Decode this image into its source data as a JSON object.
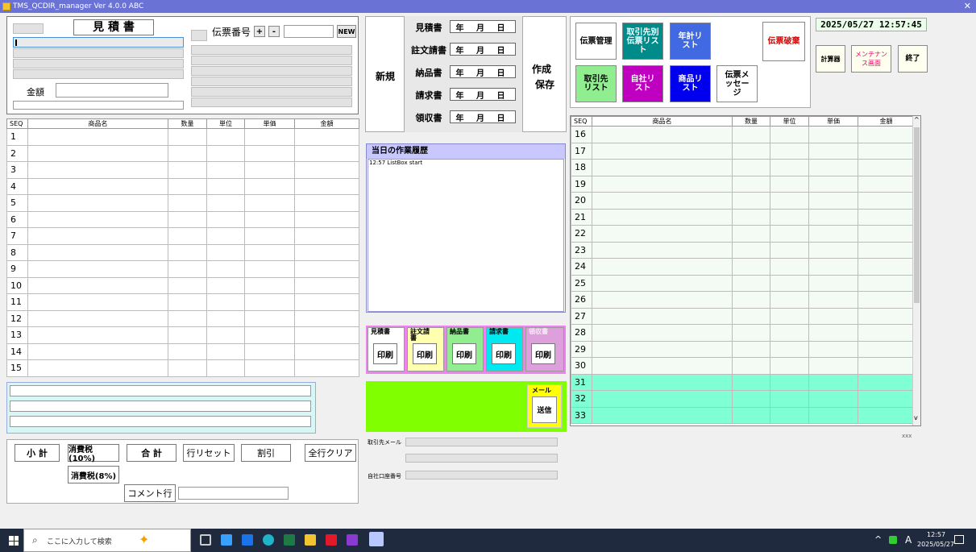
{
  "app": {
    "title": "TMS_QCDIR_manager Ver 4.0.0   ABC"
  },
  "form": {
    "doc_title": "見 積 書",
    "slip_no_label": "伝票番号",
    "plus": "+",
    "minus": "-",
    "new_label": "NEW",
    "amount_label": "金額"
  },
  "grid_left": {
    "headers": [
      "SEQ",
      "商品名",
      "数量",
      "単位",
      "単価",
      "金額"
    ],
    "rows": [
      "1",
      "2",
      "3",
      "4",
      "5",
      "6",
      "7",
      "8",
      "9",
      "10",
      "11",
      "12",
      "13",
      "14",
      "15"
    ]
  },
  "grid_right": {
    "headers": [
      "SEQ",
      "商品名",
      "数量",
      "単位",
      "単価",
      "金額"
    ],
    "rows": [
      "16",
      "17",
      "18",
      "19",
      "20",
      "21",
      "22",
      "23",
      "24",
      "25",
      "26",
      "27",
      "28",
      "29",
      "30",
      "31",
      "32",
      "33"
    ]
  },
  "actions": {
    "new": "新規",
    "create": "作成",
    "save": "保存"
  },
  "doc_types": [
    {
      "label": "見積書",
      "date": "年 月 日"
    },
    {
      "label": "註文請書",
      "date": "年 月 日"
    },
    {
      "label": "納品書",
      "date": "年 月 日"
    },
    {
      "label": "請求書",
      "date": "年 月 日"
    },
    {
      "label": "領収書",
      "date": "年 月 日"
    }
  ],
  "menu": {
    "slip_mgmt": "伝票管理",
    "partner_slip_list": "取引先別伝票リスト",
    "annual_list": "年計リスト",
    "partner_list": "取引先リスト",
    "own_list": "自社リスト",
    "product_list": "商品リスト",
    "slip_message": "伝票メッセージ",
    "slip_discard": "伝票破棄",
    "calculator": "計算器",
    "maintenance": "メンテナンス画面",
    "exit": "終了"
  },
  "clock": "2025/05/27 12:57:45",
  "history": {
    "title": "当日の作業履歴",
    "entries": [
      "12:57  ListBox start"
    ]
  },
  "print": {
    "label": "印刷",
    "groups": [
      "見積書",
      "註文請書",
      "納品書",
      "請求書",
      "領収書"
    ]
  },
  "mail": {
    "label": "メール",
    "send": "送信"
  },
  "partner_mail_label": "取引先メール",
  "bank_label": "自社口座番号",
  "footer": {
    "subtotal": "小 計",
    "tax10": "消費税(10%)",
    "total": "合 計",
    "row_reset": "行リセット",
    "discount": "割引",
    "clear_all": "全行クリア",
    "tax8": "消費税(8%)",
    "comment_row": "コメント行"
  },
  "xxx": "xxx",
  "taskbar": {
    "search_placeholder": "ここに入力して検索",
    "time": "12:57",
    "date": "2025/05/27",
    "ime": "A"
  },
  "colors": {
    "titlebar": "#6b72d6",
    "teal": "#008b8b",
    "royal": "#4169e1",
    "green": "#90ee90",
    "magenta": "#c000c0",
    "blue": "#0000ee",
    "lime": "#80ff00",
    "aquamarine": "#7fffd4",
    "pink_frame": "#ee82ee"
  }
}
